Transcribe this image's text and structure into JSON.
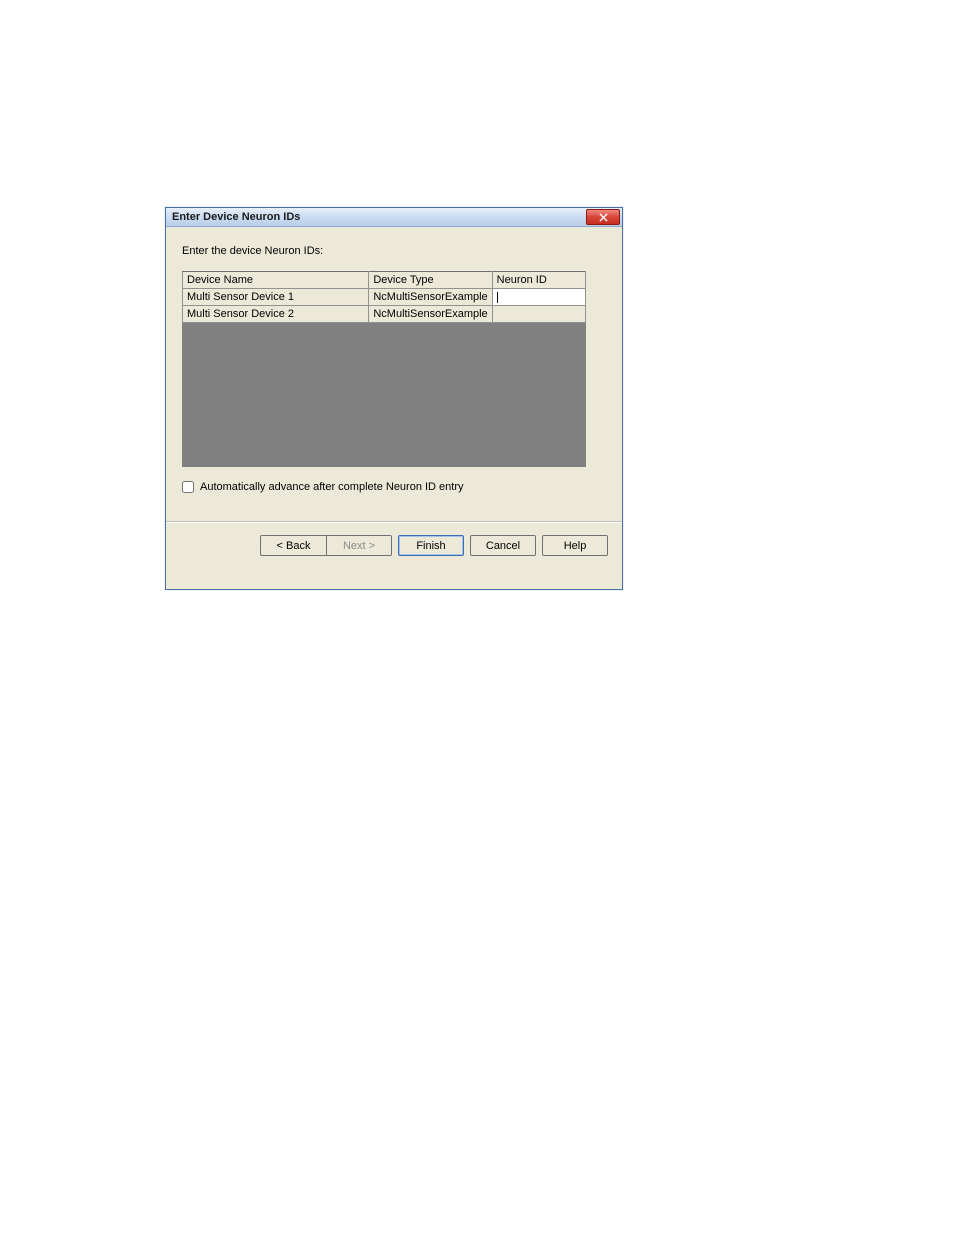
{
  "dialog": {
    "title": "Enter Device Neuron IDs",
    "instruction": "Enter the device Neuron IDs:",
    "close_icon": "close"
  },
  "table": {
    "headers": {
      "device_name": "Device Name",
      "device_type": "Device Type",
      "neuron_id": "Neuron ID"
    },
    "rows": [
      {
        "name": "Multi Sensor Device 1",
        "type": "NcMultiSensorExample",
        "neuron": ""
      },
      {
        "name": "Multi Sensor Device 2",
        "type": "NcMultiSensorExample",
        "neuron": ""
      }
    ]
  },
  "options": {
    "auto_advance_label": "Automatically advance after complete Neuron ID entry",
    "auto_advance_checked": false
  },
  "buttons": {
    "back": "< Back",
    "next": "Next >",
    "finish": "Finish",
    "cancel": "Cancel",
    "help": "Help"
  }
}
